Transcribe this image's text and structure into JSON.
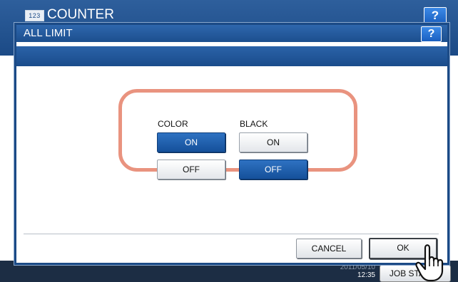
{
  "background": {
    "app_icon_text": "123",
    "title": "COUNTER",
    "help_label": "?",
    "date": "2011/05/10",
    "time": "12:35",
    "job_status_label": "JOB STATUS"
  },
  "dialog": {
    "title": "ALL LIMIT",
    "help_label": "?",
    "columns": [
      {
        "label": "COLOR",
        "on_label": "ON",
        "off_label": "OFF",
        "selected": "ON"
      },
      {
        "label": "BLACK",
        "on_label": "ON",
        "off_label": "OFF",
        "selected": "OFF"
      }
    ],
    "cancel_label": "CANCEL",
    "ok_label": "OK"
  },
  "colors": {
    "header_blue": "#1b4a86",
    "selected_blue": "#15509a",
    "highlight_ring": "#e9937f"
  },
  "icons": [
    "help-icon",
    "hand-pointer-icon"
  ]
}
